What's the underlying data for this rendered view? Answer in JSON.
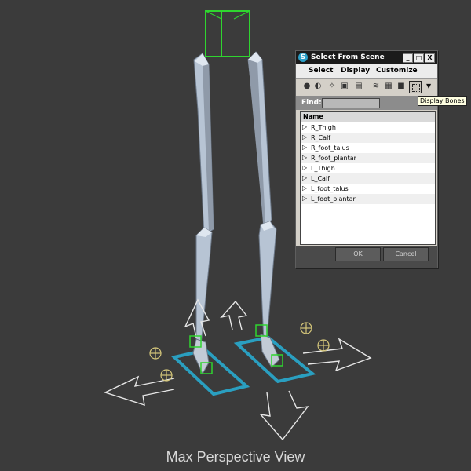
{
  "viewport": {
    "caption": "Max Perspective View"
  },
  "dialog": {
    "title": "Select From Scene",
    "window_buttons": [
      "_",
      "□",
      "X"
    ],
    "menu": [
      "Select",
      "Display",
      "Customize"
    ],
    "toolbar": {
      "icons": [
        "geometry-icon",
        "shapes-icon",
        "lights-icon",
        "cameras-icon",
        "helpers-icon",
        "spacewarps-icon",
        "groups-icon",
        "xrefs-icon",
        "bones-icon"
      ],
      "tooltip": "Display Bones"
    },
    "find": {
      "label": "Find:",
      "value": ""
    },
    "list": {
      "header": "Name",
      "items": [
        "R_Thigh",
        "R_Calf",
        "R_foot_talus",
        "R_foot_plantar",
        "L_Thigh",
        "L_Calf",
        "L_foot_talus",
        "L_foot_plantar"
      ]
    },
    "ok_label": "OK",
    "cancel_label": "Cancel"
  },
  "colors": {
    "viewport_bg": "#3b3b3b",
    "bone": "#b7c4d4",
    "helper_green": "#2fd52f",
    "ik_cyan": "#2a9fc0"
  }
}
